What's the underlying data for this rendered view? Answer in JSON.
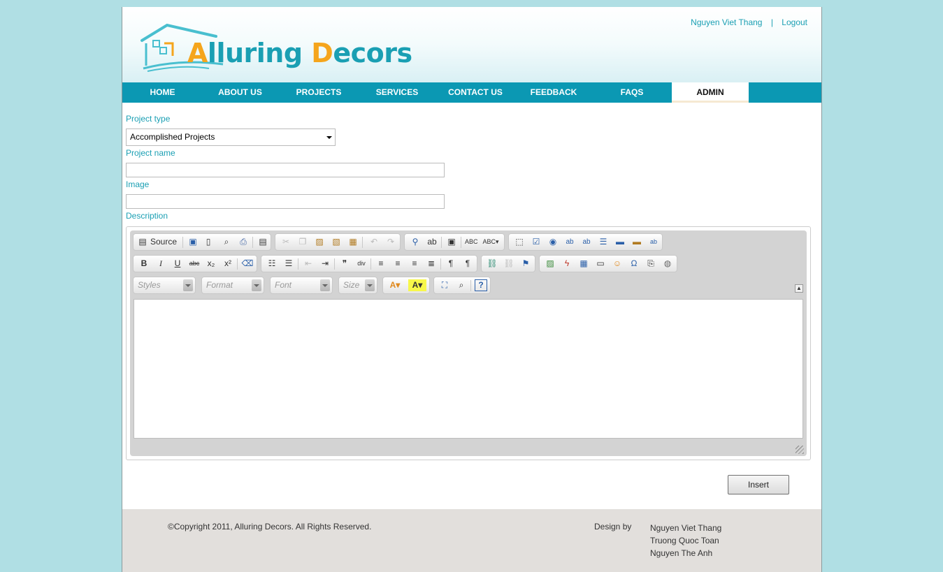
{
  "header": {
    "logo_part1": "A",
    "logo_part2": "lluring ",
    "logo_part3": "D",
    "logo_part4": "ecors",
    "user_name": "Nguyen Viet Thang",
    "separator": "|",
    "logout": "Logout"
  },
  "nav": {
    "items": [
      {
        "label": "HOME"
      },
      {
        "label": "ABOUT US"
      },
      {
        "label": "PROJECTS"
      },
      {
        "label": "SERVICES"
      },
      {
        "label": "CONTACT US"
      },
      {
        "label": "FEEDBACK"
      },
      {
        "label": "FAQS"
      },
      {
        "label": "ADMIN"
      }
    ],
    "active": "ADMIN"
  },
  "form": {
    "project_type_label": "Project type",
    "project_type_value": "Accomplished Projects",
    "project_name_label": "Project name",
    "project_name_value": "",
    "image_label": "Image",
    "image_value": "",
    "description_label": "Description"
  },
  "editor": {
    "source_label": "Source",
    "combo_styles": "Styles",
    "combo_format": "Format",
    "combo_font": "Font",
    "combo_size": "Size",
    "content": ""
  },
  "actions": {
    "insert_label": "Insert"
  },
  "footer": {
    "copyright": "©Copyright 2011, Alluring Decors. All Rights Reserved.",
    "design_by": "Design by",
    "designers": [
      "Nguyen Viet Thang",
      "Truong Quoc Toan",
      "Nguyen The Anh"
    ]
  },
  "colors": {
    "background": "#b0dfe4",
    "accent": "#0b98b3",
    "logo_orange": "#f5a51c",
    "logo_teal": "#1a9fb3"
  }
}
